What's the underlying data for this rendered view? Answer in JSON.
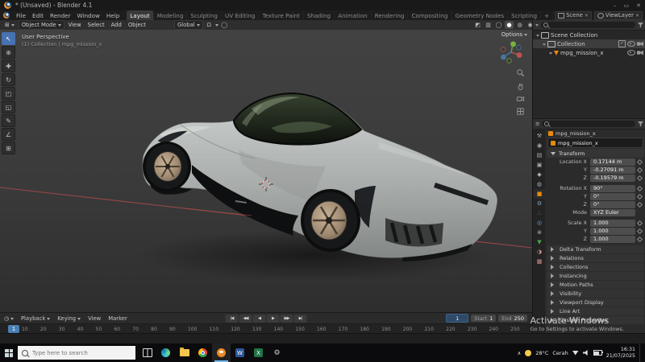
{
  "window": {
    "title": "* (Unsaved) - Blender 4.1",
    "controls": {
      "minimize": "–",
      "maximize": "▭",
      "close": "✕"
    }
  },
  "menubar": {
    "menus": [
      "File",
      "Edit",
      "Render",
      "Window",
      "Help"
    ],
    "workspaces": [
      "Layout",
      "Modeling",
      "Sculpting",
      "UV Editing",
      "Texture Paint",
      "Shading",
      "Animation",
      "Rendering",
      "Compositing",
      "Geometry Nodes",
      "Scripting"
    ],
    "add_tab": "+",
    "scene_label": "Scene",
    "viewlayer_label": "ViewLayer",
    "unlink": "✕"
  },
  "viewport_header": {
    "editor_glyph": "⊞",
    "mode": "Object Mode",
    "menus": [
      "View",
      "Select",
      "Add",
      "Object"
    ],
    "orientation": "Global",
    "icons": {
      "magnet": "Ω",
      "proportional": "◯",
      "overlays": "◩",
      "xray": "▥"
    },
    "shading_modes": [
      "◯",
      "●",
      "◍",
      "◉"
    ],
    "options": "Options"
  },
  "toolbar": {
    "glyphs": [
      "↖",
      "⊕",
      "✚",
      "↻",
      "◰",
      "◱",
      "✎",
      "∠",
      "⊞"
    ]
  },
  "viewport": {
    "perspective": "User Perspective",
    "collection": "(1) Collection | mpg_mission_x"
  },
  "outliner": {
    "rows": [
      {
        "label": "Scene Collection"
      },
      {
        "label": "Collection"
      },
      {
        "label": "mpg_mission_x"
      }
    ]
  },
  "properties": {
    "editor_glyph": "≡",
    "tabs": [
      {
        "name": "tool",
        "glyph": "⚒"
      },
      {
        "name": "render",
        "glyph": "◉"
      },
      {
        "name": "output",
        "glyph": "▤"
      },
      {
        "name": "view-layer",
        "glyph": "▣"
      },
      {
        "name": "scene",
        "glyph": "◆"
      },
      {
        "name": "world",
        "glyph": "◍"
      },
      {
        "name": "object",
        "glyph": "■"
      },
      {
        "name": "modifiers",
        "glyph": "⚙"
      },
      {
        "name": "particles",
        "glyph": "∴"
      },
      {
        "name": "physics",
        "glyph": "◎"
      },
      {
        "name": "constraints",
        "glyph": "⊗"
      },
      {
        "name": "object-data",
        "glyph": "▼"
      },
      {
        "name": "material",
        "glyph": "◑"
      },
      {
        "name": "texture",
        "glyph": "▩"
      }
    ],
    "breadcrumb": "mpg_mission_x",
    "name": "mpg_mission_x",
    "transform_title": "Transform",
    "rows": [
      {
        "label": "Location X",
        "value": "0.17144 m"
      },
      {
        "label": "Y",
        "value": "-0.27091 m"
      },
      {
        "label": "Z",
        "value": "-0.19579 m"
      },
      {
        "label": "Rotation X",
        "value": "90°"
      },
      {
        "label": "Y",
        "value": "0°"
      },
      {
        "label": "Z",
        "value": "0°"
      },
      {
        "label": "Mode",
        "value": "XYZ Euler"
      },
      {
        "label": "Scale X",
        "value": "1.000"
      },
      {
        "label": "Y",
        "value": "1.000"
      },
      {
        "label": "Z",
        "value": "1.000"
      }
    ],
    "sections": [
      "Delta Transform",
      "Relations",
      "Collections",
      "Instancing",
      "Motion Paths",
      "Visibility",
      "Viewport Display",
      "Line Art",
      "Custom Properties"
    ]
  },
  "timeline": {
    "editor_glyph": "◷",
    "menus": [
      "Playback",
      "Keying",
      "View",
      "Marker"
    ],
    "transport": [
      "|◀",
      "◀◀",
      "◀",
      "▶",
      "▶▶",
      "▶|"
    ],
    "frames": [
      "10",
      "20",
      "30",
      "40",
      "50",
      "60",
      "70",
      "80",
      "90",
      "100",
      "110",
      "120",
      "130",
      "140",
      "150",
      "160",
      "170",
      "180",
      "190",
      "200",
      "210",
      "220",
      "230",
      "240",
      "250"
    ],
    "playhead": "1",
    "current_frame": "1",
    "start_label": "Start",
    "start_value": "1",
    "end_label": "End",
    "end_value": "250"
  },
  "watermark": {
    "line1": "Activate Windows",
    "line2": "Go to Settings to activate Windows."
  },
  "taskbar": {
    "search_placeholder": "Type here to search",
    "word_letter": "W",
    "excel_letter": "X",
    "gear": "⚙",
    "tray_expand": "∧",
    "weather_temp": "28°C",
    "weather_desc": "Cerah",
    "time": "16:31",
    "date": "21/07/2025"
  },
  "colors": {
    "accent_blue": "#4772b3",
    "blender_orange": "#e8890c",
    "axis_x_red": "#a84b4b",
    "mesh_green": "#4aa84a",
    "playhead_blue": "#4a7fb5"
  }
}
